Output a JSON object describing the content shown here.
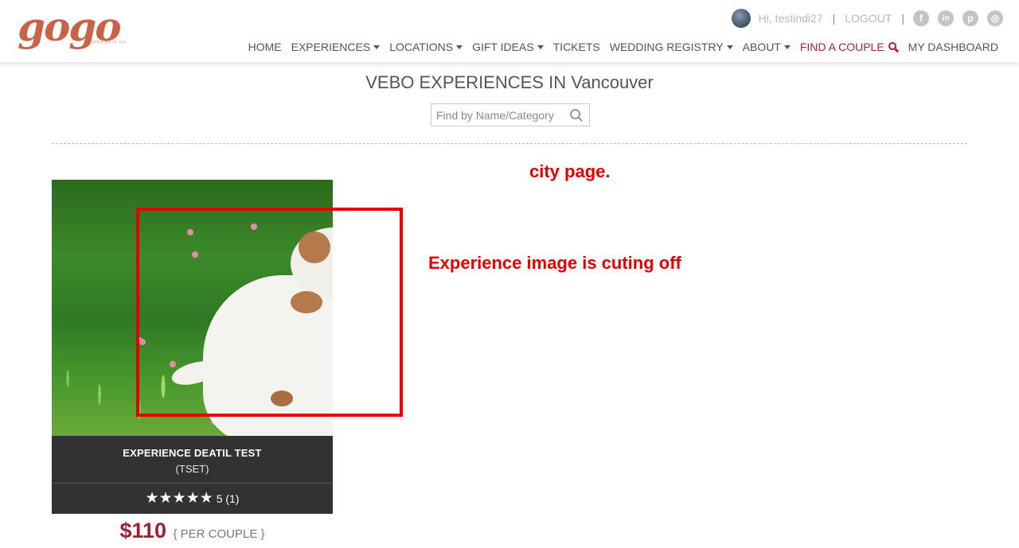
{
  "header": {
    "logo_text": "gogo",
    "logo_sub": "EXPERIENCE CO.",
    "greeting": "Hi, testindi27",
    "separator": "|",
    "logout": "LOGOUT",
    "social": [
      {
        "name": "facebook-icon",
        "glyph": "f"
      },
      {
        "name": "linkedin-icon",
        "glyph": "in"
      },
      {
        "name": "pinterest-icon",
        "glyph": "p"
      },
      {
        "name": "instagram-icon",
        "glyph": "◎"
      }
    ]
  },
  "nav": {
    "home": "HOME",
    "experiences": "EXPERIENCES",
    "locations": "LOCATIONS",
    "gift_ideas": "GIFT IDEAS",
    "tickets": "TICKETS",
    "wedding_registry": "WEDDING REGISTRY",
    "about": "ABOUT",
    "find_couple": "FIND A COUPLE",
    "dashboard": "MY DASHBOARD"
  },
  "page": {
    "title": "VEBO EXPERIENCES IN Vancouver",
    "search_placeholder": "Find by Name/Category"
  },
  "card": {
    "title": "EXPERIENCE DEATIL TEST",
    "code": "(TSET)",
    "stars": "★★★★★",
    "rating_text": "5 (1)",
    "rating_value": 5,
    "price": "$110",
    "per": "{ PER COUPLE }"
  },
  "annotations": {
    "city": "city page.",
    "image_issue": "Experience image is cuting off"
  },
  "colors": {
    "accent": "#9a2344",
    "price": "#9b2331",
    "logo": "#c8634a",
    "annotation": "#e00000",
    "card_bg": "#323232"
  }
}
